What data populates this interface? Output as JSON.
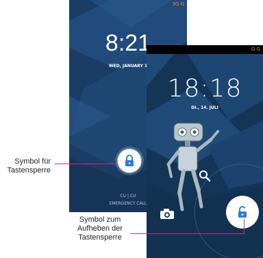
{
  "lockscreen_old": {
    "status": "3G G",
    "time": "8:21",
    "date": "WED, JANUARY 1",
    "carrier": "CU  |  CU",
    "emergency": "EMERGENCY CALL"
  },
  "lockscreen_new": {
    "status": "G G",
    "time": "18:18",
    "date": "DI., 14. JULI"
  },
  "annotations": {
    "lock_symbol": "Symbol für Tastensperre",
    "unlock_symbol": "Symbol zum Aufheben der Tastensperre"
  },
  "colors": {
    "accent_line": "#d6278a",
    "status_orange": "#ff8a1a",
    "lock_blue": "#2a7de1"
  }
}
